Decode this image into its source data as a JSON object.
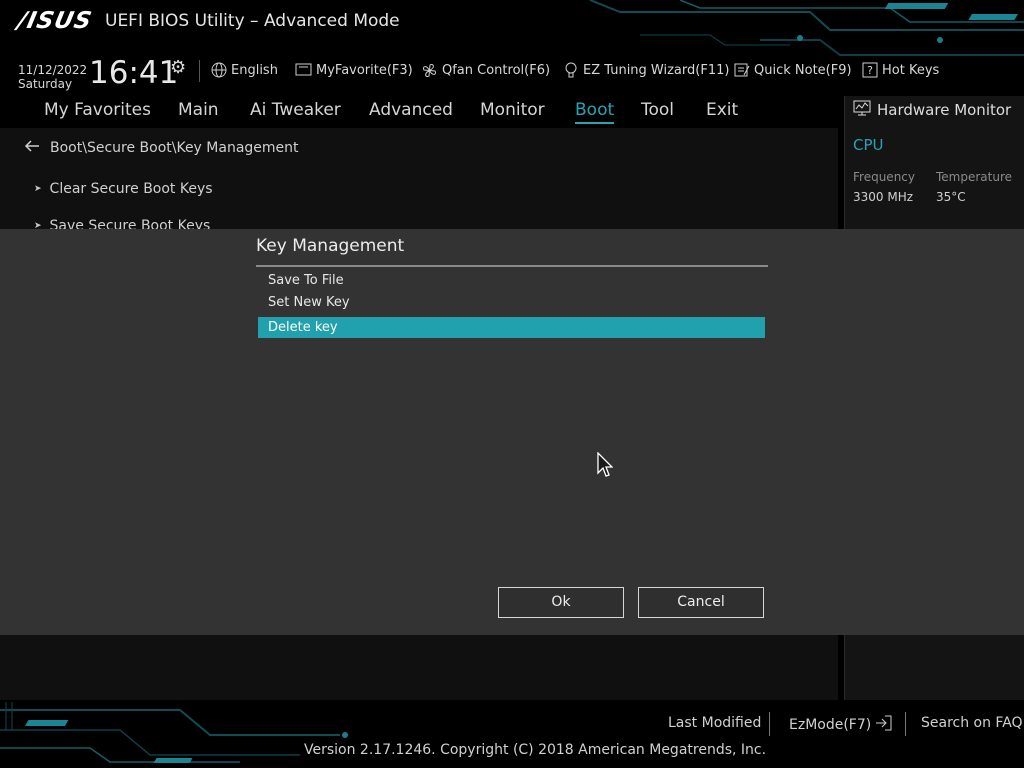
{
  "header": {
    "logo_text": "/ISUS",
    "title": "UEFI BIOS Utility – Advanced Mode"
  },
  "info": {
    "date": "11/12/2022",
    "day": "Saturday",
    "time": "16:41",
    "tools": [
      {
        "label": "English",
        "icon": "globe-icon"
      },
      {
        "label": "MyFavorite(F3)",
        "icon": "favorite-icon"
      },
      {
        "label": "Qfan Control(F6)",
        "icon": "fan-icon"
      },
      {
        "label": "EZ Tuning Wizard(F11)",
        "icon": "bulb-icon"
      },
      {
        "label": "Quick Note(F9)",
        "icon": "note-icon"
      },
      {
        "label": "Hot Keys",
        "icon": "help-icon"
      }
    ]
  },
  "menu": {
    "items": [
      "My Favorites",
      "Main",
      "Ai Tweaker",
      "Advanced",
      "Monitor",
      "Boot",
      "Tool",
      "Exit"
    ],
    "active": "Boot"
  },
  "main": {
    "breadcrumb": "Boot\\Secure Boot\\Key Management",
    "items": [
      "Clear Secure Boot Keys",
      "Save Secure Boot Keys"
    ]
  },
  "hw_monitor": {
    "title": "Hardware Monitor",
    "section": "CPU",
    "freq_label": "Frequency",
    "freq_value": "3300 MHz",
    "temp_label": "Temperature",
    "temp_value": "35°C"
  },
  "dialog": {
    "title": "Key Management",
    "options": [
      "Save To File",
      "Set New Key",
      "Delete  key"
    ],
    "selected_index": 2,
    "ok_label": "Ok",
    "cancel_label": "Cancel"
  },
  "footer": {
    "last_modified": "Last Modified",
    "ezmode": "EzMode(F7)",
    "search_faq": "Search on FAQ",
    "version": "Version 2.17.1246. Copyright (C) 2018 American Megatrends, Inc."
  },
  "colors": {
    "accent": "#26a3b4",
    "selection": "#21a1ad",
    "dialog_bg": "#333333"
  }
}
